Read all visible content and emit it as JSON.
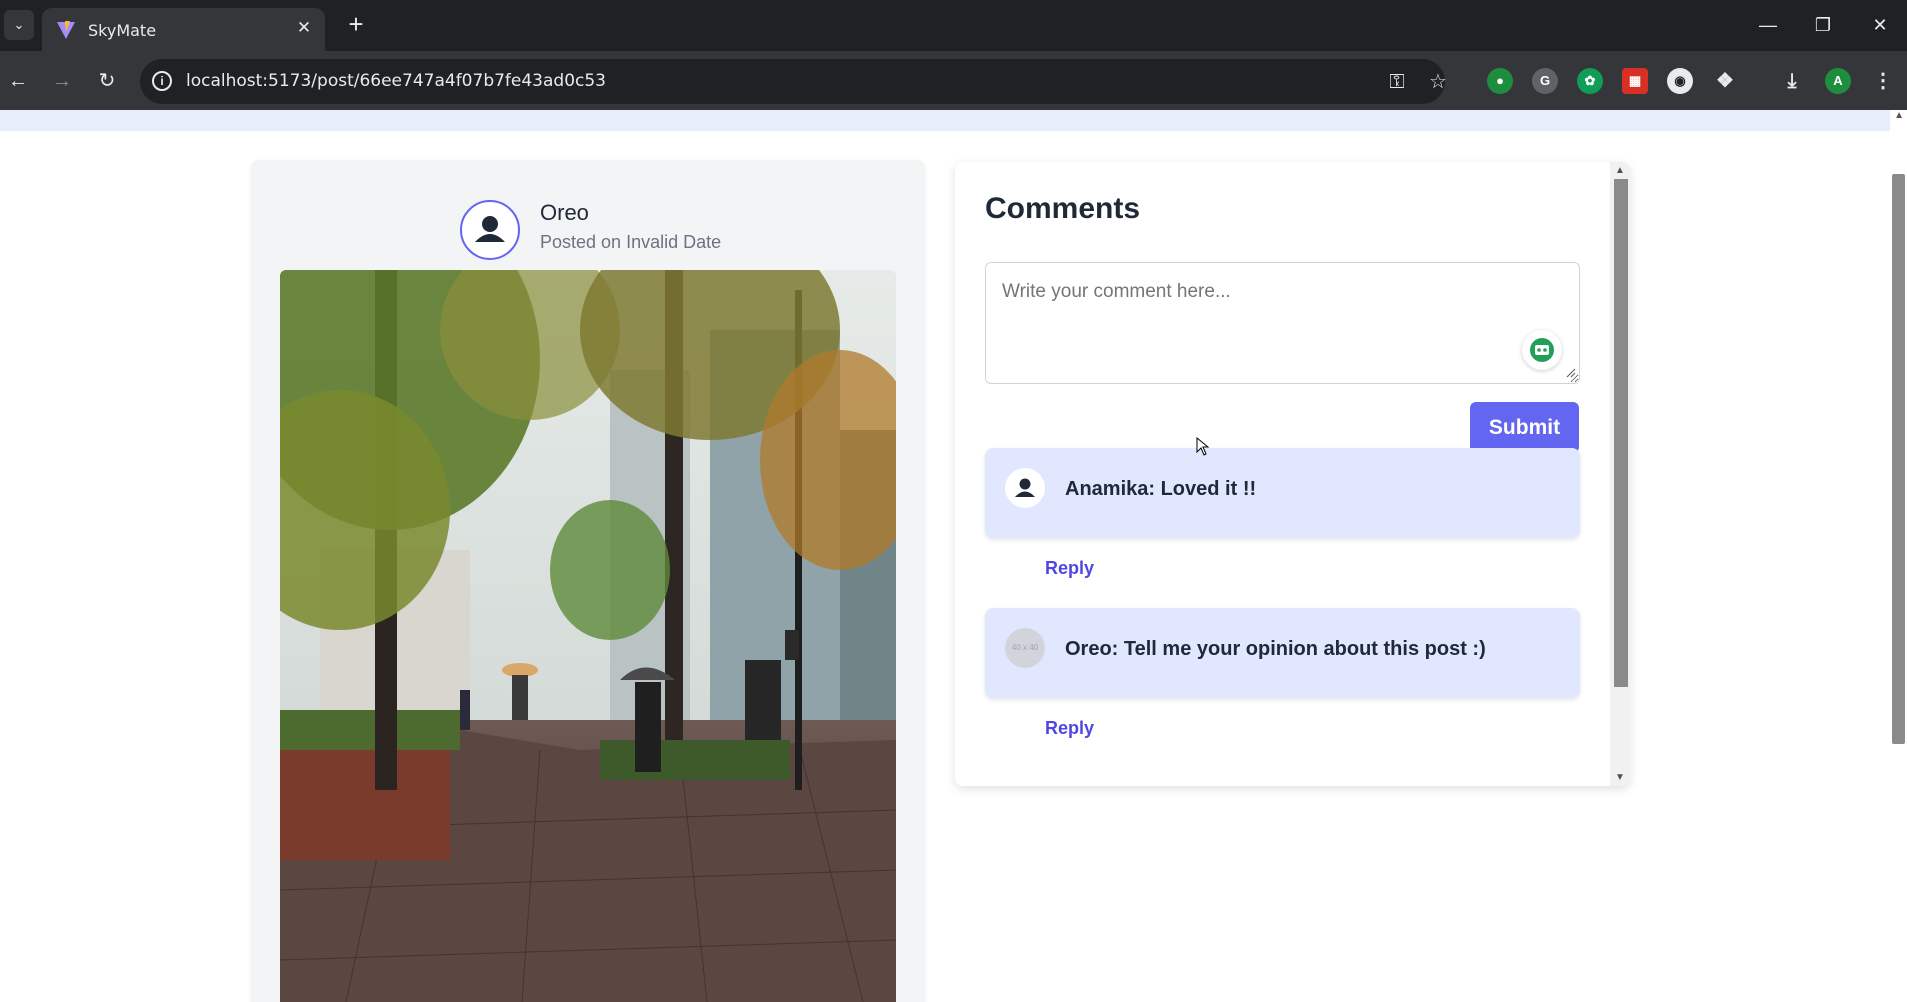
{
  "browser": {
    "tab_title": "SkyMate",
    "url": "localhost:5173/post/66ee747a4f07b7fe43ad0c53",
    "tab_close": "✕",
    "new_tab": "+",
    "profile_initial": "A"
  },
  "post": {
    "author": "Oreo",
    "posted_on": "Posted on Invalid Date",
    "image_alt": "rainy city street with autumn trees and people with umbrellas"
  },
  "comments": {
    "title": "Comments",
    "placeholder": "Write your comment here...",
    "submit_label": "Submit",
    "items": [
      {
        "text": "Anamika: Loved it !!",
        "reply_label": "Reply",
        "avatar": "user-icon"
      },
      {
        "text": "Oreo: Tell me your opinion about this post :)",
        "reply_label": "Reply",
        "avatar": "40 x 40"
      }
    ]
  },
  "colors": {
    "accent": "#6366f1",
    "comment_bg": "#e0e7ff",
    "link": "#4f46e5"
  }
}
